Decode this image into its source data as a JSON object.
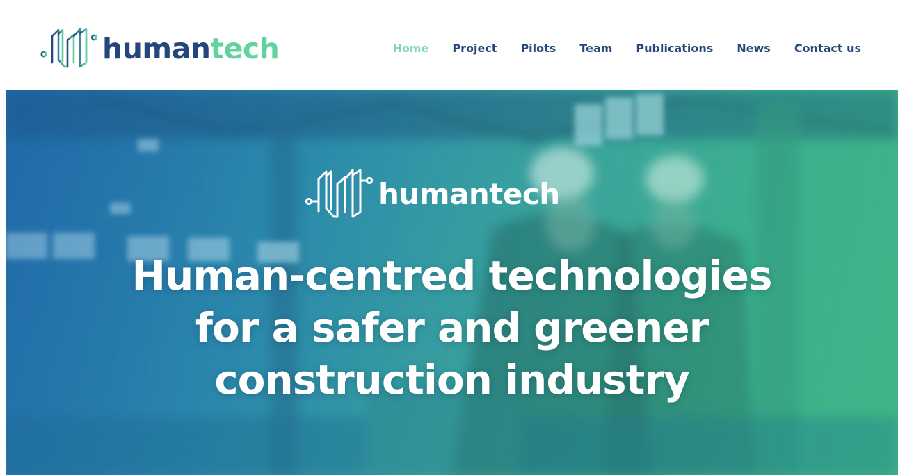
{
  "header": {
    "logo": {
      "icon": "humantech-circuit-logo-icon",
      "text_part_1": "human",
      "text_part_2": "tech",
      "colors": {
        "primary": "#24467a",
        "accent": "#62d39f"
      }
    },
    "nav": {
      "items": [
        {
          "label": "Home",
          "active": true
        },
        {
          "label": "Project",
          "active": false
        },
        {
          "label": "Pilots",
          "active": false
        },
        {
          "label": "Team",
          "active": false
        },
        {
          "label": "Publications",
          "active": false
        },
        {
          "label": "News",
          "active": false
        },
        {
          "label": "Contact us",
          "active": false
        }
      ],
      "colors": {
        "default": "#24467a",
        "active": "#7fd8b3"
      }
    }
  },
  "hero": {
    "background": "blurred-construction-site-workers-photo",
    "overlay_colors": [
      "#236da8",
      "#40b584"
    ],
    "logo": {
      "icon": "humantech-circuit-logo-icon",
      "text": "humantech"
    },
    "headline": {
      "line_1": "Human-centred technologies",
      "line_2": "for a safer and greener",
      "line_3": "construction industry"
    }
  }
}
